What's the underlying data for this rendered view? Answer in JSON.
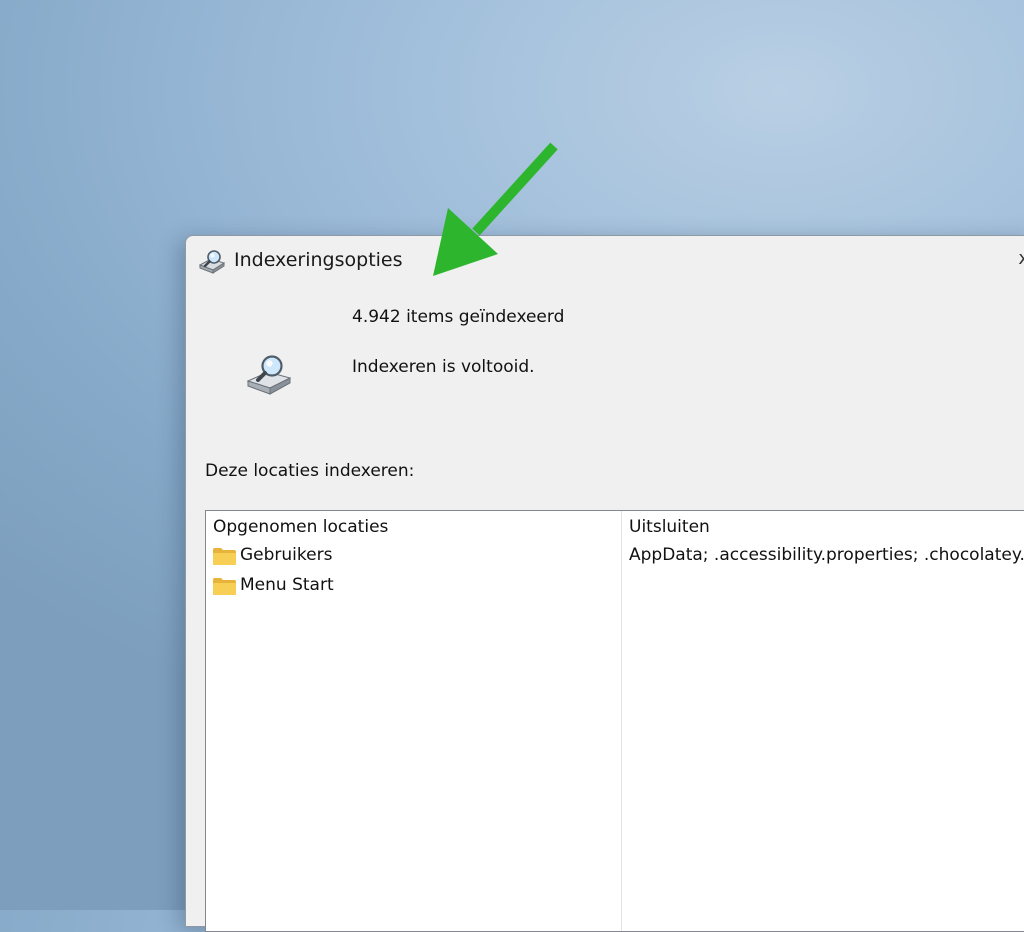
{
  "window": {
    "title": "Indexeringsopties",
    "close_glyph": "x",
    "title_icon": "indexing-options-icon"
  },
  "status": {
    "items_count": "4.942 items geïndexeerd",
    "message": "Indexeren is voltooid.",
    "icon": "indexing-drive-magnifier-icon"
  },
  "locations": {
    "label": "Deze locaties indexeren:",
    "columns": [
      "Opgenomen locaties",
      "Uitsluiten"
    ],
    "rows": [
      {
        "location": "Gebruikers",
        "exclude": "AppData; .accessibility.properties; .chocolatey..."
      },
      {
        "location": "Menu Start",
        "exclude": ""
      }
    ]
  },
  "annotation": {
    "arrow_color": "#2db52d"
  }
}
